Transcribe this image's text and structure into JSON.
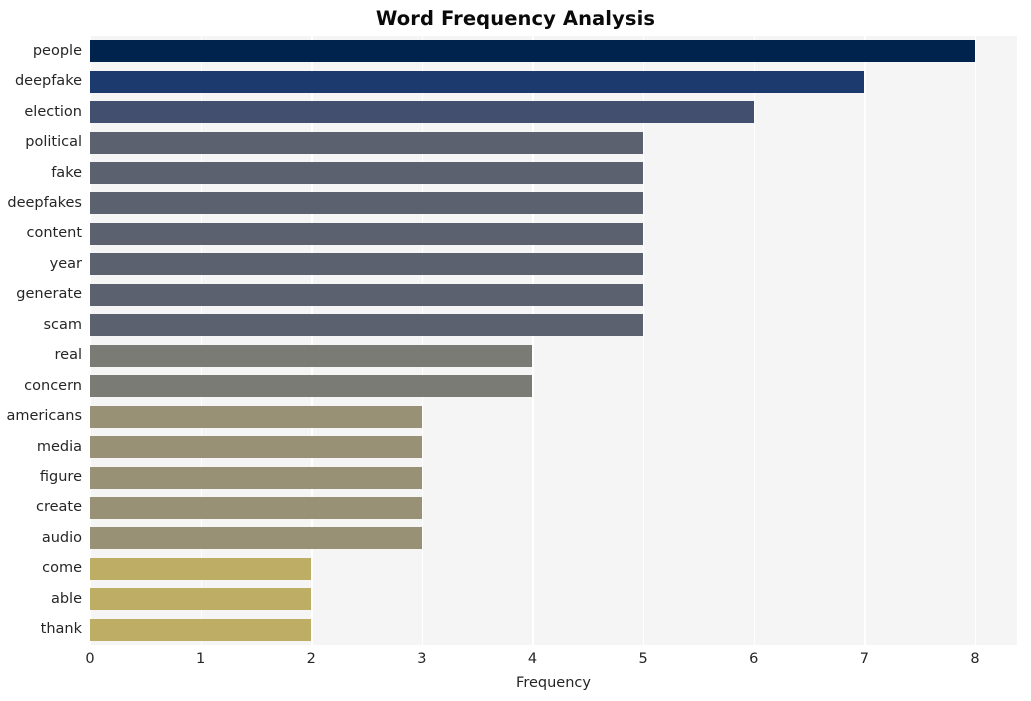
{
  "chart_data": {
    "type": "bar",
    "orientation": "horizontal",
    "title": "Word Frequency Analysis",
    "xlabel": "Frequency",
    "ylabel": "",
    "xlim": [
      0,
      8.38
    ],
    "xticks": [
      0,
      1,
      2,
      3,
      4,
      5,
      6,
      7,
      8
    ],
    "xtick_labels": [
      "0",
      "1",
      "2",
      "3",
      "4",
      "5",
      "6",
      "7",
      "8"
    ],
    "grid": "vertical-only",
    "legend": "none",
    "categories": [
      "people",
      "deepfake",
      "election",
      "political",
      "fake",
      "deepfakes",
      "content",
      "year",
      "generate",
      "scam",
      "real",
      "concern",
      "americans",
      "media",
      "figure",
      "create",
      "audio",
      "come",
      "able",
      "thank"
    ],
    "values": [
      8,
      7,
      6,
      5,
      5,
      5,
      5,
      5,
      5,
      5,
      4,
      4,
      3,
      3,
      3,
      3,
      3,
      2,
      2,
      2
    ],
    "bar_colors": [
      "#00234e",
      "#1d3a6e",
      "#434f6e",
      "#5c6170",
      "#5c6170",
      "#5c6170",
      "#5c6170",
      "#5c6170",
      "#5c6170",
      "#5c6170",
      "#7b7b76",
      "#7b7b76",
      "#989175",
      "#989175",
      "#989175",
      "#989175",
      "#989175",
      "#bdad65",
      "#bdad65",
      "#bdad65"
    ],
    "plot_background": "#f5f5f5",
    "grid_color": "#ffffff",
    "figure_background": "#ffffff",
    "text_color": "#262626",
    "title_color": "#0a0a0a"
  }
}
